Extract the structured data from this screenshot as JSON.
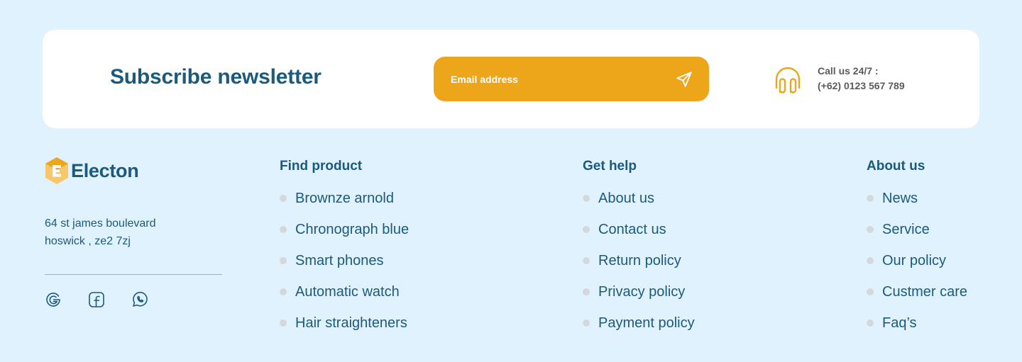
{
  "newsletter": {
    "title": "Subscribe newsletter",
    "email_placeholder": "Email address",
    "call_label": "Call us 24/7 :",
    "call_number": "(+62) 0123 567 789"
  },
  "brand": {
    "name": "Electon",
    "address_line1": "64 st james boulevard",
    "address_line2": "hoswick , ze2 7zj"
  },
  "social": [
    "google-icon",
    "facebook-icon",
    "whatsapp-icon"
  ],
  "columns": [
    {
      "title": "Find product",
      "items": [
        "Brownze arnold",
        "Chronograph blue",
        "Smart phones",
        "Automatic watch",
        "Hair straighteners"
      ]
    },
    {
      "title": "Get help",
      "items": [
        "About us",
        "Contact us",
        "Return policy",
        "Privacy policy",
        "Payment policy"
      ]
    },
    {
      "title": "About us",
      "items": [
        "News",
        "Service",
        "Our policy",
        "Custmer care",
        "Faq’s"
      ]
    }
  ],
  "colors": {
    "background": "#e0f2fd",
    "accent": "#eda619",
    "brand_text": "#1b5a7d",
    "bullet": "#d4d8db"
  }
}
